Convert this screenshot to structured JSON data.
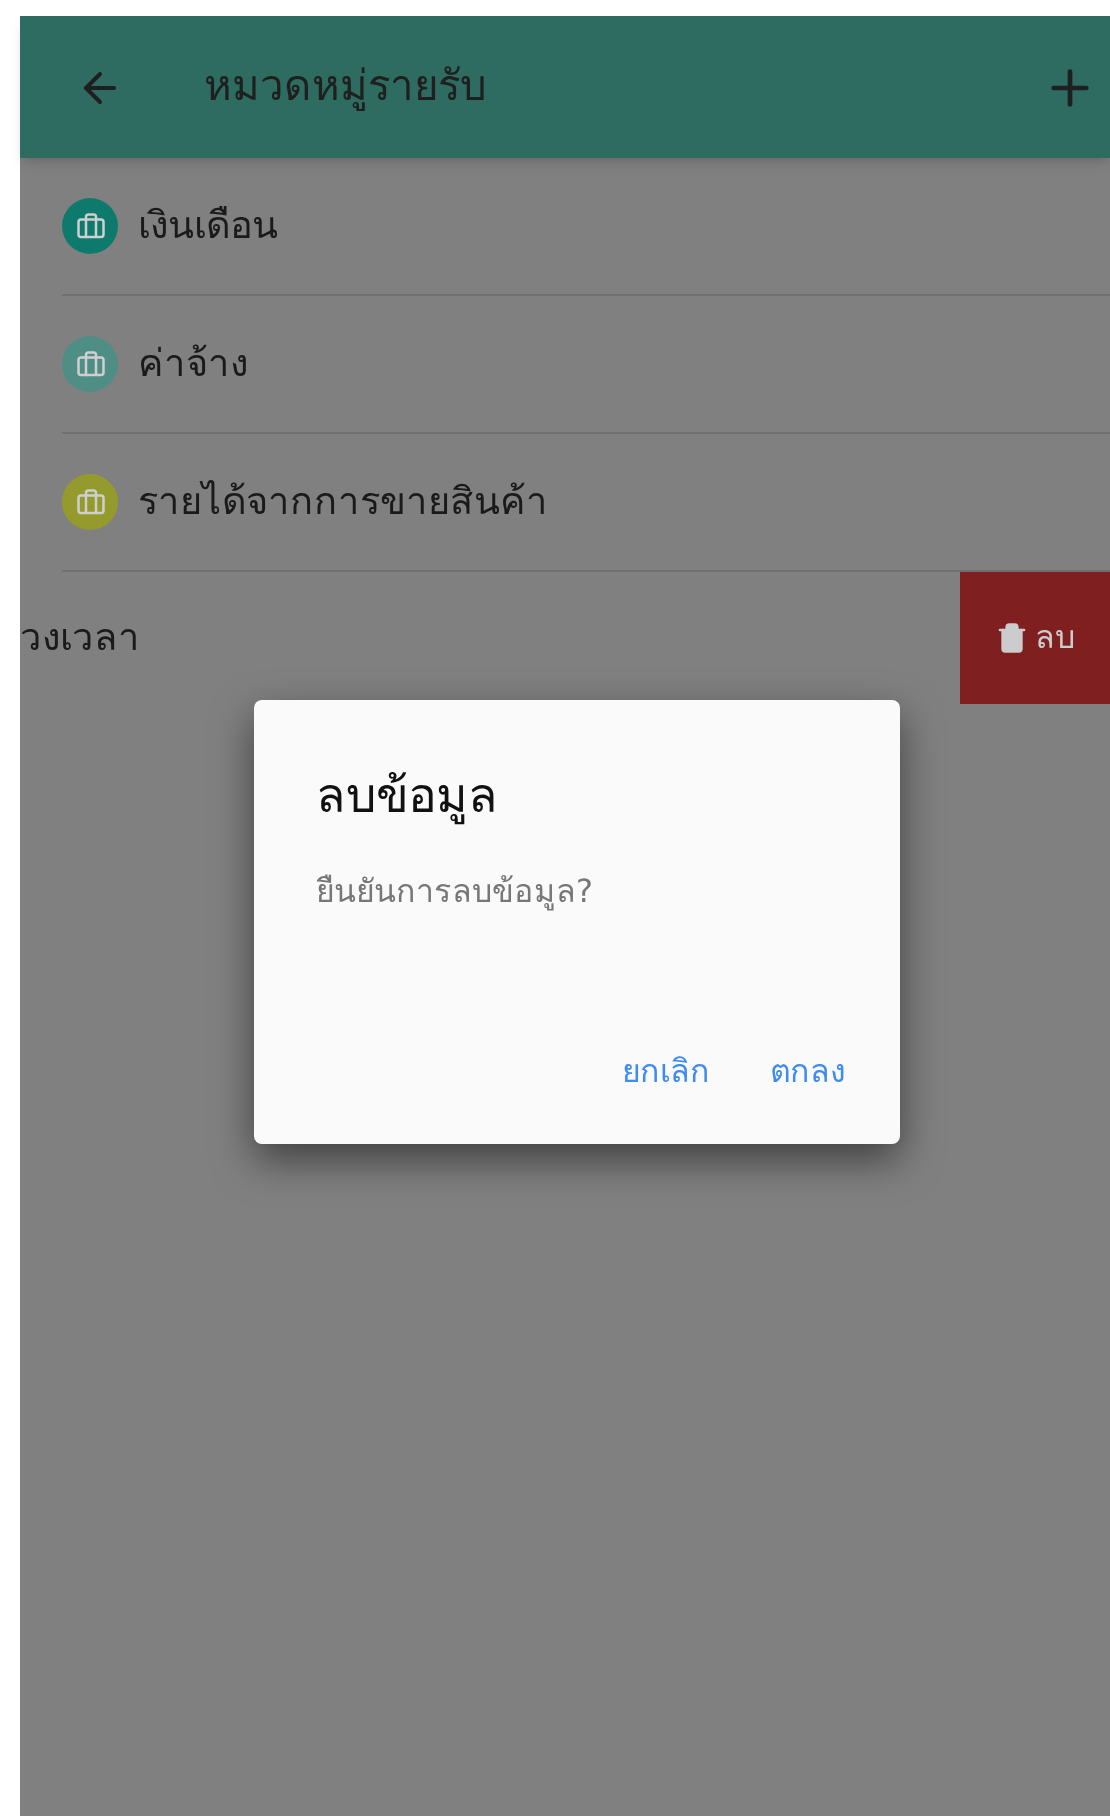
{
  "app_bar": {
    "title": "หมวดหมู่รายรับ"
  },
  "categories": [
    {
      "name": "เงินเดือน",
      "color": "#0e7a6d"
    },
    {
      "name": "ค่าจ้าง",
      "color": "#4e8e84"
    },
    {
      "name": "รายได้จากการขายสินค้า",
      "color": "#949a2c"
    }
  ],
  "swiped_row": {
    "name": "วงเวลา",
    "action": "ลบ"
  },
  "dialog": {
    "title": "ลบข้อมูล",
    "message": "ยืนยันการลบข้อมูล?",
    "buttons": [
      "ยกเลิก",
      "ตกลง"
    ]
  }
}
